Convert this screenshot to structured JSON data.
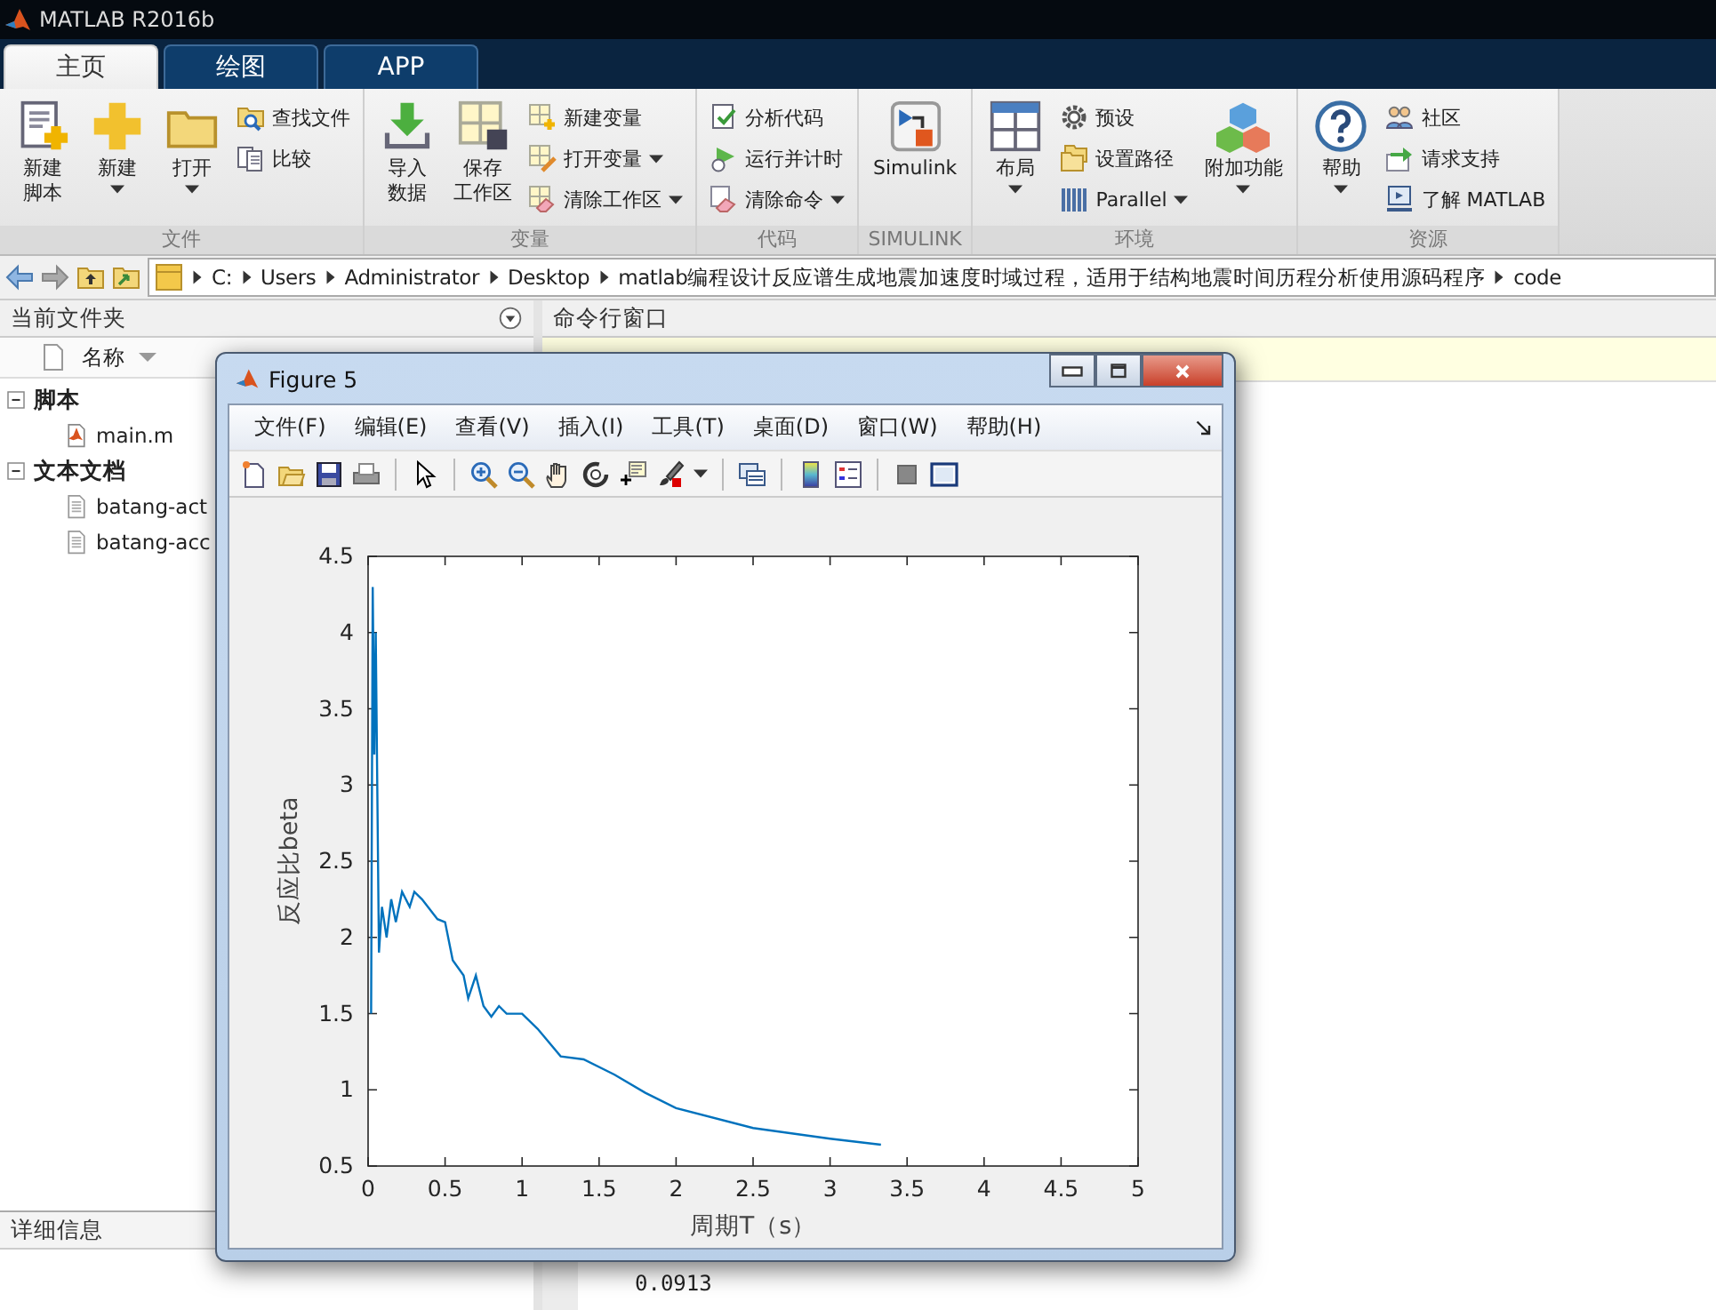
{
  "window": {
    "title": "MATLAB R2016b"
  },
  "tabs": [
    {
      "label": "主页",
      "selected": true
    },
    {
      "label": "绘图",
      "selected": false
    },
    {
      "label": "APP",
      "selected": false
    }
  ],
  "ribbon": {
    "groups": [
      {
        "label": "文件",
        "items": [
          {
            "kind": "large",
            "lines": [
              "新建",
              "脚本"
            ],
            "dropdown": false
          },
          {
            "kind": "large",
            "lines": [
              "新建"
            ],
            "dropdown": true
          },
          {
            "kind": "large",
            "lines": [
              "打开"
            ],
            "dropdown": true
          },
          {
            "kind": "small",
            "label": "查找文件",
            "dropdown": false
          },
          {
            "kind": "small",
            "label": "比较",
            "dropdown": false
          }
        ]
      },
      {
        "label": "变量",
        "items": [
          {
            "kind": "large",
            "lines": [
              "导入",
              "数据"
            ],
            "dropdown": false
          },
          {
            "kind": "large",
            "lines": [
              "保存",
              "工作区"
            ],
            "dropdown": false
          },
          {
            "kind": "small",
            "label": "新建变量",
            "dropdown": false
          },
          {
            "kind": "small",
            "label": "打开变量",
            "dropdown": true
          },
          {
            "kind": "small",
            "label": "清除工作区",
            "dropdown": true
          }
        ]
      },
      {
        "label": "代码",
        "items": [
          {
            "kind": "small",
            "label": "分析代码",
            "dropdown": false
          },
          {
            "kind": "small",
            "label": "运行并计时",
            "dropdown": false
          },
          {
            "kind": "small",
            "label": "清除命令",
            "dropdown": true
          }
        ]
      },
      {
        "label": "SIMULINK",
        "items": [
          {
            "kind": "large",
            "lines": [
              "Simulink"
            ],
            "dropdown": false
          }
        ]
      },
      {
        "label": "环境",
        "items": [
          {
            "kind": "large",
            "lines": [
              "布局"
            ],
            "dropdown": true
          },
          {
            "kind": "small",
            "label": "预设",
            "dropdown": false
          },
          {
            "kind": "small",
            "label": "设置路径",
            "dropdown": false
          },
          {
            "kind": "small",
            "label": "Parallel",
            "dropdown": true
          },
          {
            "kind": "large",
            "lines": [
              "附加功能"
            ],
            "dropdown": true
          }
        ]
      },
      {
        "label": "资源",
        "items": [
          {
            "kind": "large",
            "lines": [
              "帮助"
            ],
            "dropdown": true
          },
          {
            "kind": "small",
            "label": "社区",
            "dropdown": false
          },
          {
            "kind": "small",
            "label": "请求支持",
            "dropdown": false
          },
          {
            "kind": "small",
            "label": "了解 MATLAB",
            "dropdown": false
          }
        ]
      }
    ]
  },
  "address_bar": {
    "path": [
      "C:",
      "Users",
      "Administrator",
      "Desktop",
      "matlab编程设计反应谱生成地震加速度时域过程，适用于结构地震时间历程分析使用源码程序",
      "code"
    ]
  },
  "current_folder": {
    "title": "当前文件夹",
    "column": "名称",
    "tree": [
      {
        "label": "脚本",
        "expanded": true,
        "children": [
          {
            "label": "main.m",
            "kind": "mfile"
          }
        ]
      },
      {
        "label": "文本文档",
        "expanded": true,
        "children": [
          {
            "label": "batang-act",
            "kind": "text"
          },
          {
            "label": "batang-acc",
            "kind": "text"
          }
        ]
      }
    ],
    "details_title": "详细信息"
  },
  "command_window": {
    "title": "命令行窗口",
    "output": [
      "0.0913"
    ]
  },
  "figure": {
    "title": "Figure 5",
    "menu": [
      "文件(F)",
      "编辑(E)",
      "查看(V)",
      "插入(I)",
      "工具(T)",
      "桌面(D)",
      "窗口(W)",
      "帮助(H)"
    ],
    "chart_data": {
      "type": "line",
      "xlabel": "周期T（s）",
      "ylabel": "反应比beta",
      "x": [
        0.02,
        0.03,
        0.04,
        0.05,
        0.07,
        0.09,
        0.12,
        0.15,
        0.18,
        0.22,
        0.27,
        0.3,
        0.35,
        0.45,
        0.5,
        0.55,
        0.62,
        0.65,
        0.7,
        0.75,
        0.8,
        0.85,
        0.9,
        1.0,
        1.1,
        1.25,
        1.4,
        1.6,
        1.8,
        2.0,
        2.5,
        3.0,
        3.33
      ],
      "series": [
        {
          "color": "#0072bd",
          "values": [
            1.5,
            4.3,
            3.2,
            4.0,
            1.9,
            2.2,
            2.0,
            2.25,
            2.1,
            2.3,
            2.2,
            2.3,
            2.25,
            2.12,
            2.1,
            1.85,
            1.75,
            1.6,
            1.75,
            1.55,
            1.48,
            1.55,
            1.5,
            1.5,
            1.4,
            1.22,
            1.2,
            1.1,
            0.98,
            0.88,
            0.75,
            0.68,
            0.64
          ]
        }
      ],
      "xlim": [
        0,
        5
      ],
      "ylim": [
        0.5,
        4.5
      ],
      "xticks": [
        0,
        0.5,
        1,
        1.5,
        2,
        2.5,
        3,
        3.5,
        4,
        4.5,
        5
      ],
      "yticks": [
        0.5,
        1,
        1.5,
        2,
        2.5,
        3,
        3.5,
        4,
        4.5
      ]
    }
  }
}
